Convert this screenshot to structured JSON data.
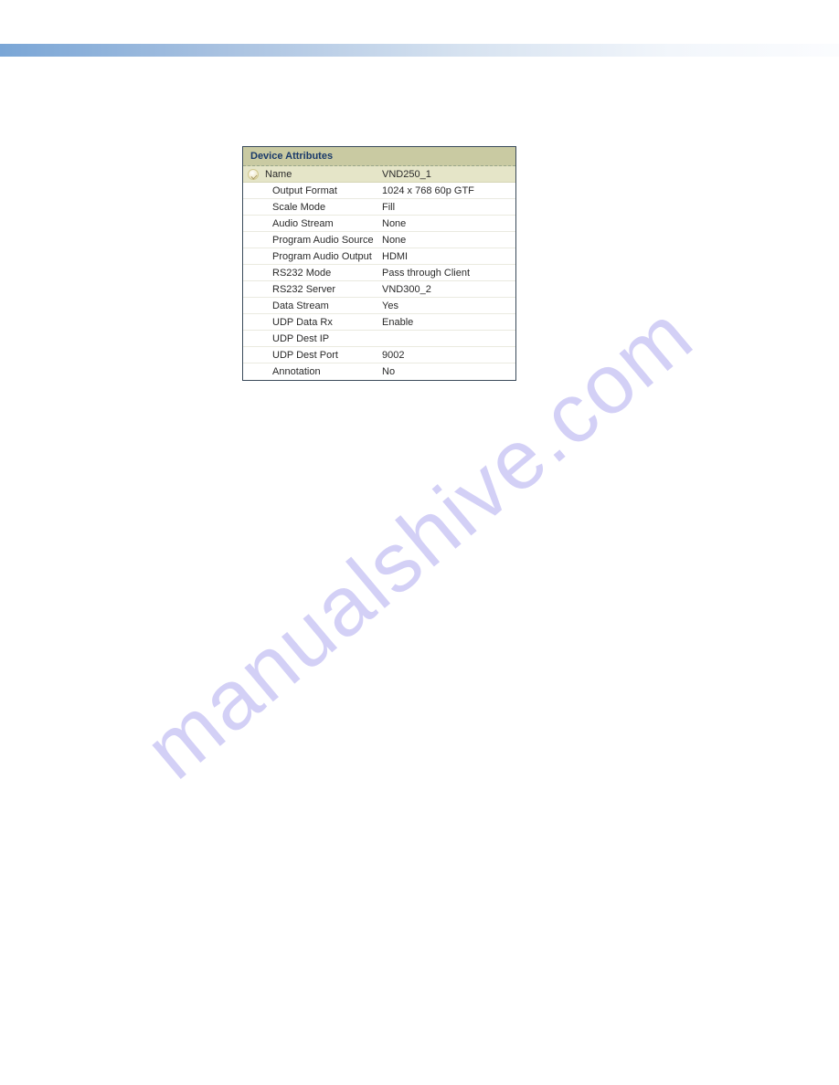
{
  "watermark": "manualshive.com",
  "panel": {
    "title": "Device Attributes",
    "rows": [
      {
        "label": "Name",
        "value": "VND250_1"
      },
      {
        "label": "Output Format",
        "value": "1024 x 768 60p GTF"
      },
      {
        "label": "Scale Mode",
        "value": "Fill"
      },
      {
        "label": "Audio Stream",
        "value": "None"
      },
      {
        "label": "Program Audio Source",
        "value": "None"
      },
      {
        "label": "Program Audio Output",
        "value": "HDMI"
      },
      {
        "label": "RS232 Mode",
        "value": "Pass through Client"
      },
      {
        "label": "RS232 Server",
        "value": "VND300_2"
      },
      {
        "label": "Data Stream",
        "value": "Yes"
      },
      {
        "label": "UDP Data Rx",
        "value": "Enable"
      },
      {
        "label": "UDP Dest IP",
        "value": ""
      },
      {
        "label": "UDP Dest Port",
        "value": "9002"
      },
      {
        "label": "Annotation",
        "value": "No"
      }
    ]
  }
}
